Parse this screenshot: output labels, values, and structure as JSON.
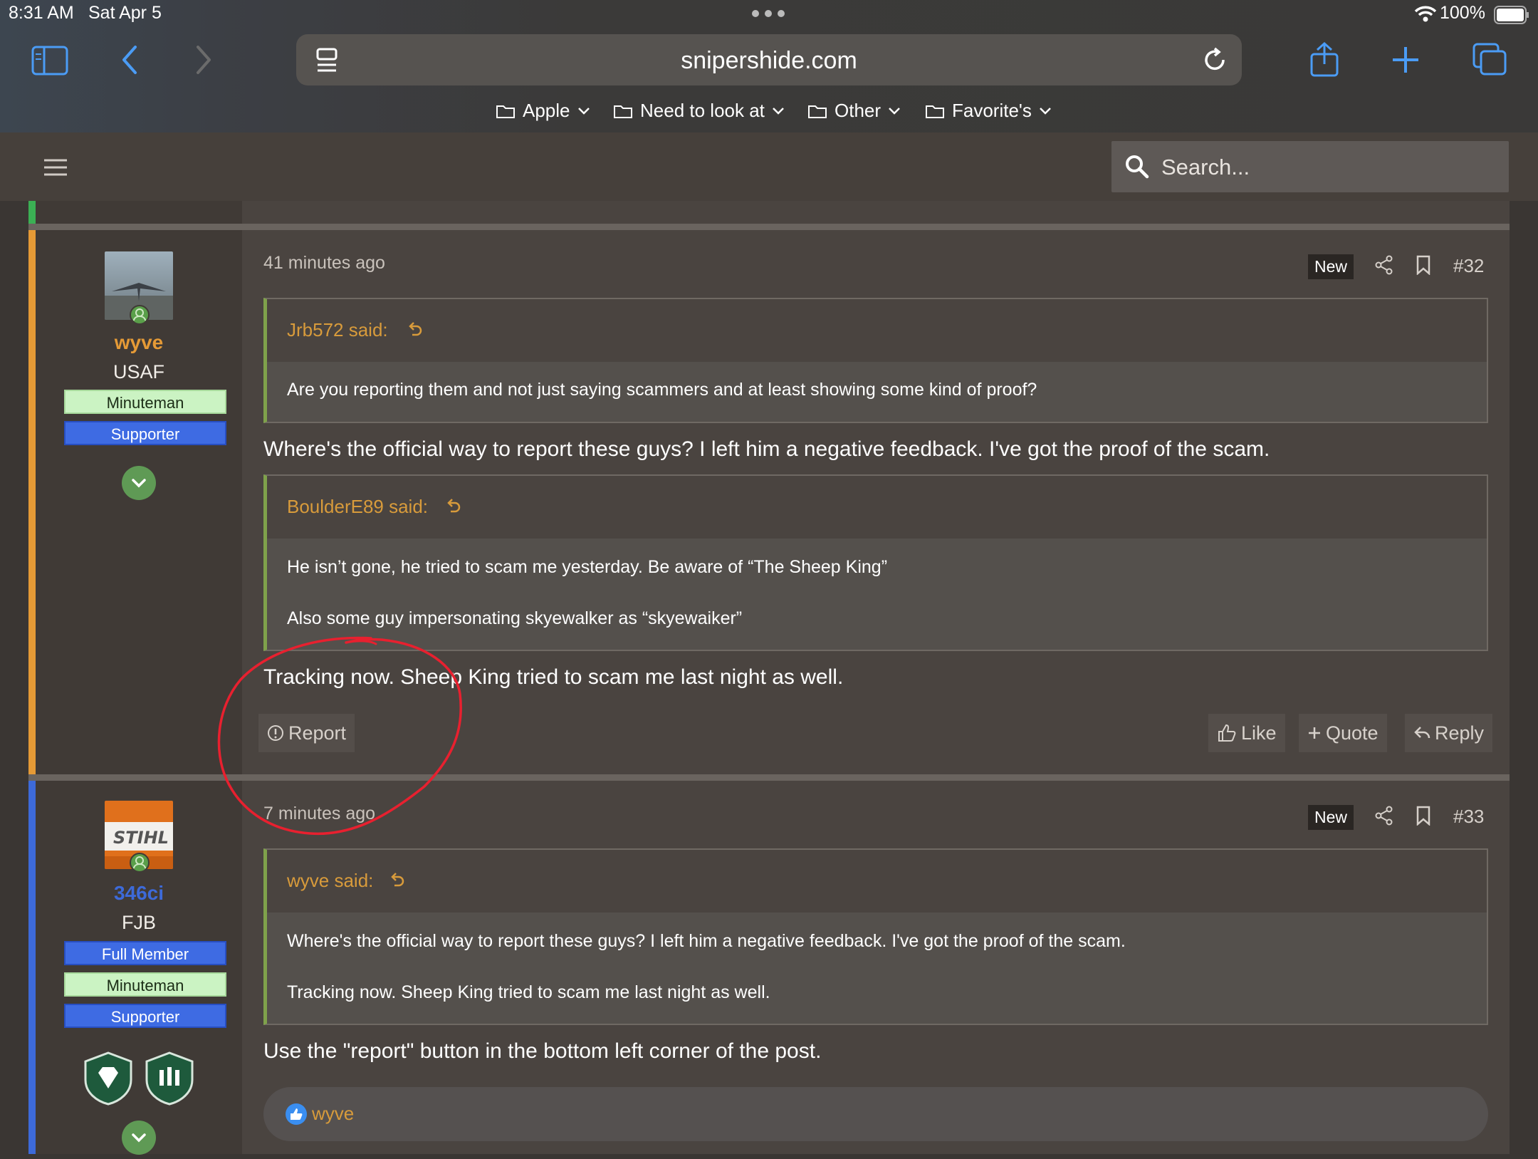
{
  "status_bar": {
    "time": "8:31 AM",
    "date": "Sat Apr 5",
    "battery": "100%"
  },
  "browser": {
    "url": "snipershide.com",
    "bookmarks": [
      {
        "label": "Apple"
      },
      {
        "label": "Need to look at"
      },
      {
        "label": "Other"
      },
      {
        "label": "Favorite's"
      }
    ]
  },
  "header": {
    "search_placeholder": "Search..."
  },
  "posts": [
    {
      "author": "wyve",
      "author_title": "USAF",
      "badges": [
        "Minuteman",
        "Supporter"
      ],
      "time": "41 minutes ago",
      "new_label": "New",
      "number": "#32",
      "quotes": [
        {
          "author": "Jrb572 said:",
          "lines": [
            "Are you reporting them and not just saying scammers and at least showing some kind of proof?"
          ]
        },
        {
          "author": "BoulderE89 said:",
          "lines": [
            "He isn’t gone, he tried to scam me yesterday. Be aware of “The Sheep King”",
            "Also some guy impersonating skyewalker as “skyewaiker”"
          ]
        }
      ],
      "messages": [
        "Where's the official way to report these guys? I left him a negative feedback. I've got the proof of the scam.",
        "Tracking now. Sheep King tried to scam me last night as well."
      ],
      "actions": {
        "report": "Report",
        "like": "Like",
        "quote": "Quote",
        "reply": "Reply"
      }
    },
    {
      "author": "346ci",
      "author_title": "FJB",
      "badges": [
        "Full Member",
        "Minuteman",
        "Supporter"
      ],
      "time": "7 minutes ago",
      "new_label": "New",
      "number": "#33",
      "quotes": [
        {
          "author": "wyve said:",
          "lines": [
            "Where's the official way to report these guys? I left him a negative feedback. I've got the proof of the scam.",
            "Tracking now. Sheep King tried to scam me last night as well."
          ]
        }
      ],
      "messages": [
        "Use the \"report\" button in the bottom left corner of the post."
      ],
      "reaction_user": "wyve"
    }
  ],
  "colors": {
    "accent_orange": "#d89b3b",
    "post1_bar": "#e59a36",
    "post2_bar": "#3d6ad9",
    "annotation_red": "#e8202f"
  }
}
